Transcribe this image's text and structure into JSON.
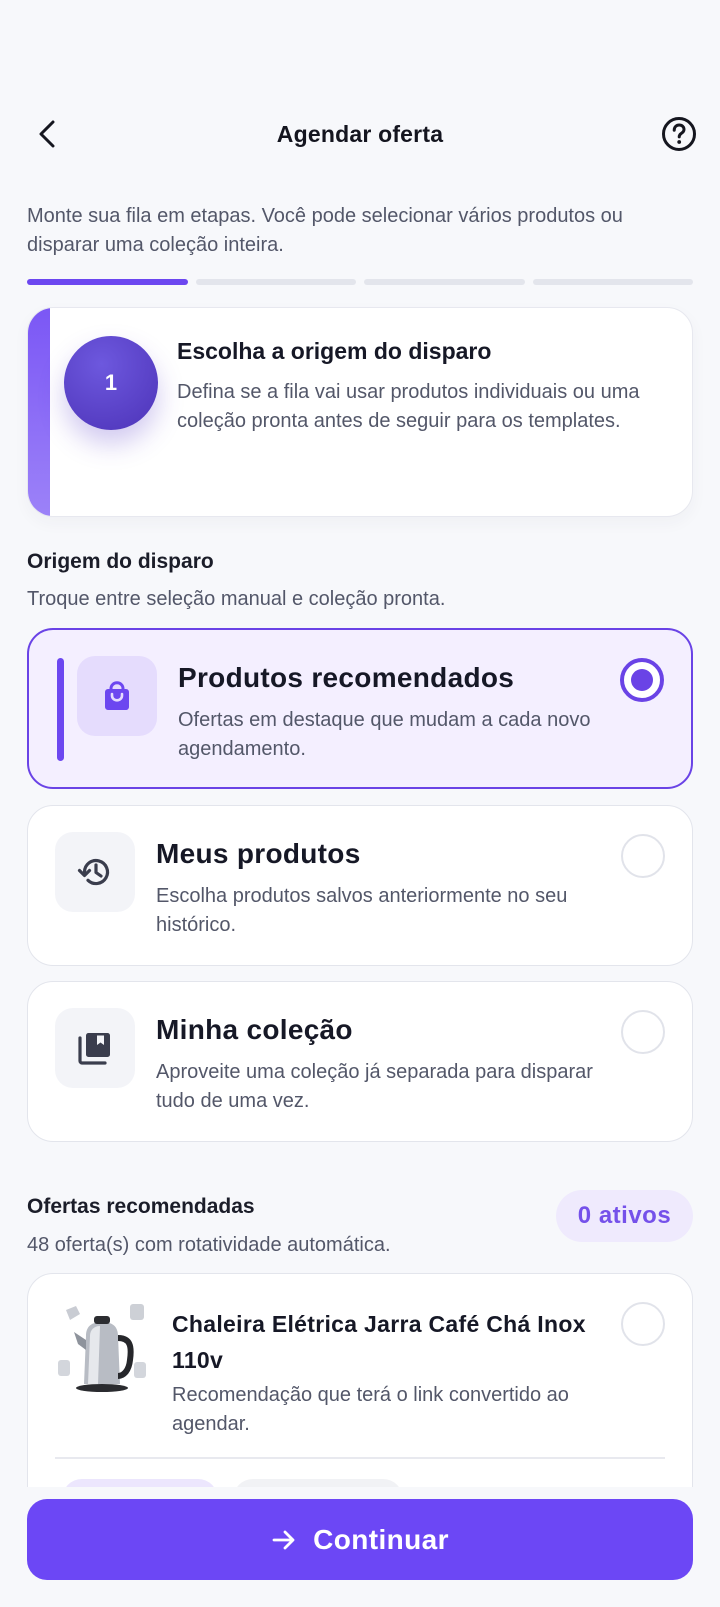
{
  "header": {
    "title": "Agendar oferta",
    "back_icon": "chevron-left-icon",
    "help_icon": "help-circle-icon"
  },
  "intro": "Monte sua fila em etapas. Você pode selecionar vários produtos ou disparar uma coleção inteira.",
  "progress": {
    "total_steps": 4,
    "current_step": 1
  },
  "step": {
    "number": "1",
    "title": "Escolha a origem do disparo",
    "description": "Defina se a fila vai usar produtos individuais ou uma coleção pronta antes de seguir para os templates."
  },
  "origin": {
    "title": "Origem do disparo",
    "subtitle": "Troque entre seleção manual e coleção pronta.",
    "options": [
      {
        "title": "Produtos recomendados",
        "description": "Ofertas em destaque que mudam a cada novo agendamento.",
        "icon": "shopping-bag-icon",
        "selected": true
      },
      {
        "title": "Meus produtos",
        "description": "Escolha produtos salvos anteriormente no seu histórico.",
        "icon": "history-icon",
        "selected": false
      },
      {
        "title": "Minha coleção",
        "description": "Aproveite uma coleção já separada para disparar tudo de uma vez.",
        "icon": "collections-icon",
        "selected": false
      }
    ]
  },
  "offers": {
    "title": "Ofertas recomendadas",
    "subtitle": "48 oferta(s) com rotatividade automática.",
    "badge": "0 ativos",
    "items": [
      {
        "title": "Chaleira Elétrica Jarra Café Chá Inox 110v",
        "description": "Recomendação que terá o link convertido ao agendar.",
        "selected": false
      }
    ]
  },
  "footer": {
    "continue_label": "Continuar",
    "continue_icon": "arrow-right-icon"
  },
  "colors": {
    "accent": "#6c47f0",
    "selected_bg": "#f4efff",
    "text_primary": "#161826",
    "text_secondary": "#535769"
  }
}
